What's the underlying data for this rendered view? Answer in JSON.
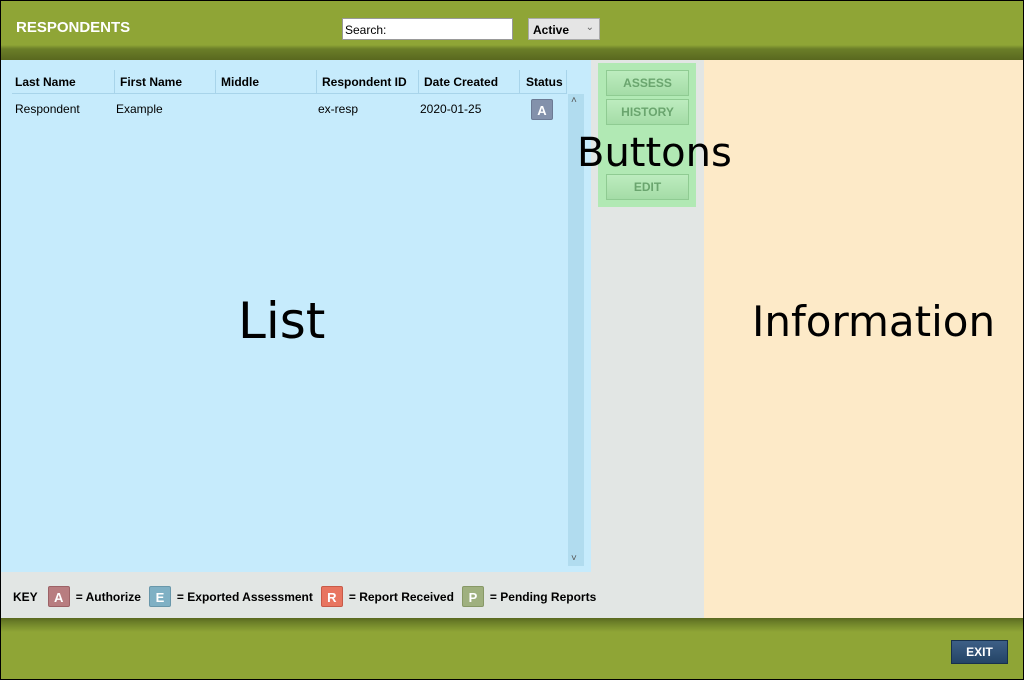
{
  "header": {
    "title": "RESPONDENTS",
    "search_placeholder": "Search:",
    "filter_value": "Active"
  },
  "list": {
    "columns": [
      "Last Name",
      "First Name",
      "Middle",
      "Respondent ID",
      "Date Created",
      "Status"
    ],
    "rows": [
      {
        "last": "Respondent",
        "first": "Example",
        "middle": "",
        "id": "ex-resp",
        "date": "2020-01-25",
        "status": "A"
      }
    ]
  },
  "buttons": {
    "assess": "ASSESS",
    "history": "HISTORY",
    "edit": "EDIT"
  },
  "overlay_labels": {
    "list": "List",
    "buttons": "Buttons",
    "information": "Information"
  },
  "key": {
    "label": "KEY",
    "items": [
      {
        "letter": "A",
        "text": "= Authorize",
        "color": "#b87d80"
      },
      {
        "letter": "E",
        "text": "= Exported Assessment",
        "color": "#7fb0c4"
      },
      {
        "letter": "R",
        "text": "= Report Received",
        "color": "#e87560"
      },
      {
        "letter": "P",
        "text": "= Pending Reports",
        "color": "#9fb07f"
      }
    ]
  },
  "footer": {
    "exit": "EXIT"
  },
  "colors": {
    "header": "#8fa536",
    "list_bg": "#c6ebfc",
    "info_bg": "#fdeac8",
    "buttons_bg": "#b1e9b4",
    "status_badge": "#8391ab"
  }
}
